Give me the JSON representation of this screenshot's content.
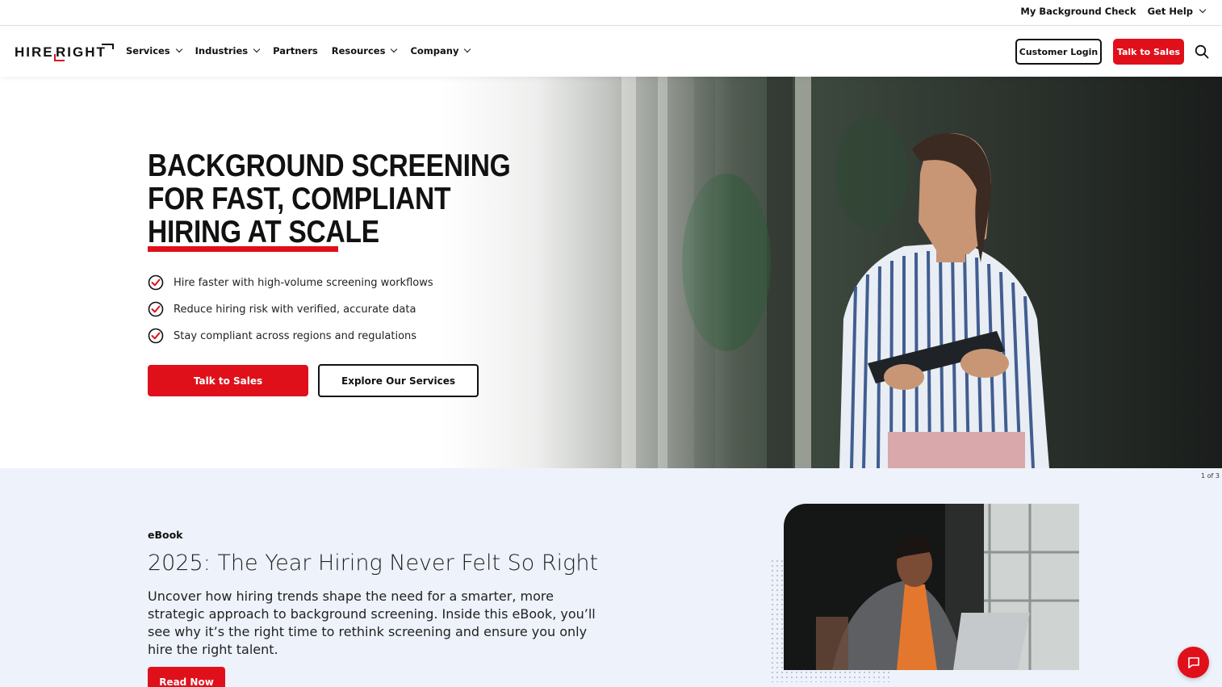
{
  "utility_bar": {
    "my_background_check": "My Background Check",
    "get_help": "Get Help"
  },
  "nav": {
    "logo_text_left": "HIRE",
    "logo_text_right": "RIGHT",
    "items": [
      {
        "label": "Services",
        "has_dropdown": true
      },
      {
        "label": "Industries",
        "has_dropdown": true
      },
      {
        "label": "Partners",
        "has_dropdown": false
      },
      {
        "label": "Resources",
        "has_dropdown": true
      },
      {
        "label": "Company",
        "has_dropdown": true
      }
    ],
    "customer_login": "Customer Login",
    "talk_to_sales": "Talk to Sales",
    "search_icon": "search-icon"
  },
  "hero": {
    "title_lines": [
      "BACKGROUND SCREENING",
      "FOR FAST, COMPLIANT",
      "HIRING AT SCALE"
    ],
    "bullets": [
      "Hire faster with high-volume screening workflows",
      "Reduce hiring risk with verified, accurate data",
      "Stay compliant across regions and regulations"
    ],
    "primary_cta": "Talk to Sales",
    "secondary_cta": "Explore Our Services",
    "slide_indicator": "1 of 3"
  },
  "promo": {
    "kicker": "eBook",
    "title": "2025: The Year Hiring Never Felt So Right",
    "description": "Uncover how hiring trends shape the need for a smarter, more strategic approach to background screening. Inside this eBook, you’ll see why it’s the right time to rethink screening and ensure you only hire the right talent.",
    "cta": "Read Now"
  },
  "colors": {
    "brand_red": "#e0101b",
    "text_dark": "#111111",
    "promo_bg": "#eef2fb"
  }
}
